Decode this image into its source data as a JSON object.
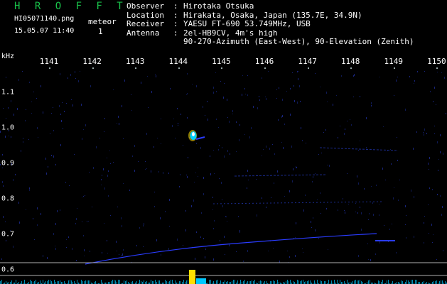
{
  "header": {
    "app_title": "H R O F F T",
    "filename": "HI05071140.png",
    "datetime": "15.05.07 11:40",
    "meteor_label": "meteor",
    "meteor_count": "1"
  },
  "station_info": [
    {
      "key": "Observer",
      "sep": ":",
      "value": "Hirotaka Otsuka"
    },
    {
      "key": "Location",
      "sep": ":",
      "value": "Hirakata, Osaka, Japan (135.7E, 34.9N)"
    },
    {
      "key": "Receiver",
      "sep": ":",
      "value": "YAESU FT-690 53.749MHz, USB"
    },
    {
      "key": "Antenna",
      "sep": ":",
      "value": "2el-HB9CV, 4m's high"
    },
    {
      "key": "",
      "sep": "",
      "value": "90-270-Azimuth (East-West), 90-Elevation (Zenith)"
    }
  ],
  "axis": {
    "y_unit": "kHz",
    "x_ticks": [
      "1141",
      "1142",
      "1143",
      "1144",
      "1145",
      "1146",
      "1147",
      "1148",
      "1149",
      "1150"
    ],
    "y_ticks": [
      "1.1",
      "1.0",
      "0.9",
      "0.8",
      "0.7",
      "0.6"
    ]
  },
  "colors": {
    "background": "#000000",
    "title": "#19c24a",
    "text": "#ffffff",
    "trace": "#2a3cff",
    "echo_core": "#ffffff",
    "echo_mid": "#00d0ff",
    "echo_edge": "#ffe000",
    "baseline_line": "#b0b0b0",
    "spectrum": "#00c8ff",
    "spectrum_peak": "#ffe000"
  }
}
